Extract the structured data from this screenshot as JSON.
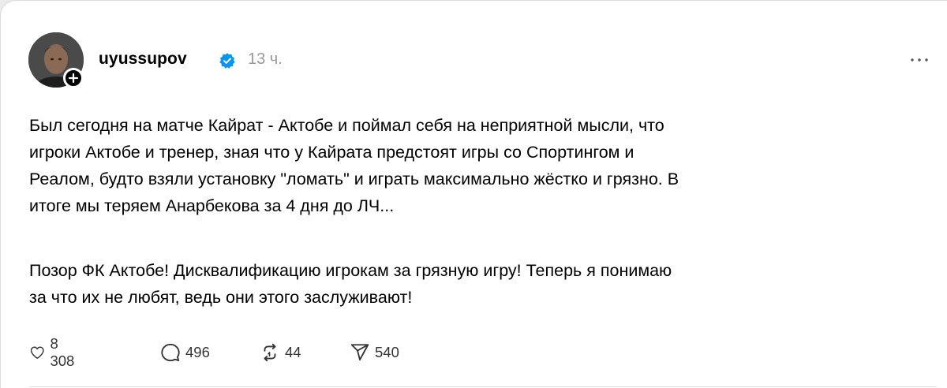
{
  "post": {
    "username": "uyussupov",
    "timestamp": "13 ч.",
    "paragraphs": [
      {
        "lines": [
          "Был сегодня на матче Кайрат - Актобе и поймал себя на неприятной мысли, что",
          "игроки Актобе и тренер, зная что у Кайрата предстоят игры со Спортингом и",
          "Реалом, будто взяли установку \"ломать\" и играть максимально жёстко и грязно. В",
          "итоге мы теряем Анарбекова за 4 дня до ЛЧ..."
        ]
      },
      {
        "lines": [
          "Позор ФК Актобе! Дисквалификацию игрокам за грязную игру! Теперь я понимаю",
          "за что их не любят, ведь они этого заслуживают!"
        ]
      }
    ],
    "actions": {
      "likes": "8 308",
      "comments": "496",
      "reposts": "44",
      "shares": "540"
    }
  },
  "icons": {
    "avatar": "profile-photo",
    "follow": "plus-icon",
    "verified": "verified-badge-icon",
    "more": "more-horizontal-icon",
    "like": "heart-icon",
    "comment": "comment-bubble-icon",
    "repost": "repost-icon",
    "share": "send-icon"
  },
  "colors": {
    "verified": "#0095f6",
    "timestamp": "#999999",
    "text": "#000000"
  }
}
